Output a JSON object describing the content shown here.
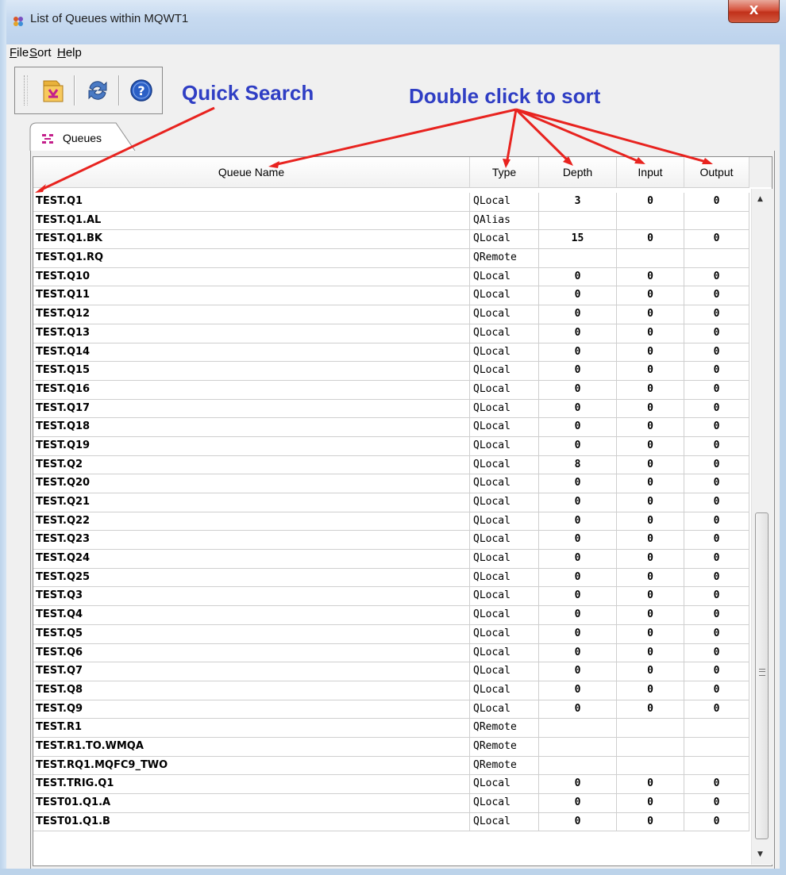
{
  "window": {
    "title": "List of Queues within MQWT1",
    "close_glyph": "X"
  },
  "menu": {
    "file": "ile",
    "file_key": "F",
    "sort": "ort",
    "sort_key": "S",
    "help": "elp",
    "help_key": "H"
  },
  "toolbar": {
    "icons": [
      "folder-open-icon",
      "refresh-icon",
      "help-icon"
    ]
  },
  "annotations": {
    "quick_search": "Quick Search",
    "double_click": "Double click to sort"
  },
  "tab": {
    "label": "Queues"
  },
  "columns": [
    "Queue Name",
    "Type",
    "Depth",
    "Input",
    "Output"
  ],
  "rows": [
    {
      "name": "TEST.Q1",
      "type": "QLocal",
      "depth": "3",
      "input": "0",
      "output": "0"
    },
    {
      "name": "TEST.Q1.AL",
      "type": "QAlias",
      "depth": "",
      "input": "",
      "output": ""
    },
    {
      "name": "TEST.Q1.BK",
      "type": "QLocal",
      "depth": "15",
      "input": "0",
      "output": "0"
    },
    {
      "name": "TEST.Q1.RQ",
      "type": "QRemote",
      "depth": "",
      "input": "",
      "output": ""
    },
    {
      "name": "TEST.Q10",
      "type": "QLocal",
      "depth": "0",
      "input": "0",
      "output": "0"
    },
    {
      "name": "TEST.Q11",
      "type": "QLocal",
      "depth": "0",
      "input": "0",
      "output": "0"
    },
    {
      "name": "TEST.Q12",
      "type": "QLocal",
      "depth": "0",
      "input": "0",
      "output": "0"
    },
    {
      "name": "TEST.Q13",
      "type": "QLocal",
      "depth": "0",
      "input": "0",
      "output": "0"
    },
    {
      "name": "TEST.Q14",
      "type": "QLocal",
      "depth": "0",
      "input": "0",
      "output": "0"
    },
    {
      "name": "TEST.Q15",
      "type": "QLocal",
      "depth": "0",
      "input": "0",
      "output": "0"
    },
    {
      "name": "TEST.Q16",
      "type": "QLocal",
      "depth": "0",
      "input": "0",
      "output": "0"
    },
    {
      "name": "TEST.Q17",
      "type": "QLocal",
      "depth": "0",
      "input": "0",
      "output": "0"
    },
    {
      "name": "TEST.Q18",
      "type": "QLocal",
      "depth": "0",
      "input": "0",
      "output": "0"
    },
    {
      "name": "TEST.Q19",
      "type": "QLocal",
      "depth": "0",
      "input": "0",
      "output": "0"
    },
    {
      "name": "TEST.Q2",
      "type": "QLocal",
      "depth": "8",
      "input": "0",
      "output": "0"
    },
    {
      "name": "TEST.Q20",
      "type": "QLocal",
      "depth": "0",
      "input": "0",
      "output": "0"
    },
    {
      "name": "TEST.Q21",
      "type": "QLocal",
      "depth": "0",
      "input": "0",
      "output": "0"
    },
    {
      "name": "TEST.Q22",
      "type": "QLocal",
      "depth": "0",
      "input": "0",
      "output": "0"
    },
    {
      "name": "TEST.Q23",
      "type": "QLocal",
      "depth": "0",
      "input": "0",
      "output": "0"
    },
    {
      "name": "TEST.Q24",
      "type": "QLocal",
      "depth": "0",
      "input": "0",
      "output": "0"
    },
    {
      "name": "TEST.Q25",
      "type": "QLocal",
      "depth": "0",
      "input": "0",
      "output": "0"
    },
    {
      "name": "TEST.Q3",
      "type": "QLocal",
      "depth": "0",
      "input": "0",
      "output": "0"
    },
    {
      "name": "TEST.Q4",
      "type": "QLocal",
      "depth": "0",
      "input": "0",
      "output": "0"
    },
    {
      "name": "TEST.Q5",
      "type": "QLocal",
      "depth": "0",
      "input": "0",
      "output": "0"
    },
    {
      "name": "TEST.Q6",
      "type": "QLocal",
      "depth": "0",
      "input": "0",
      "output": "0"
    },
    {
      "name": "TEST.Q7",
      "type": "QLocal",
      "depth": "0",
      "input": "0",
      "output": "0"
    },
    {
      "name": "TEST.Q8",
      "type": "QLocal",
      "depth": "0",
      "input": "0",
      "output": "0"
    },
    {
      "name": "TEST.Q9",
      "type": "QLocal",
      "depth": "0",
      "input": "0",
      "output": "0"
    },
    {
      "name": "TEST.R1",
      "type": "QRemote",
      "depth": "",
      "input": "",
      "output": ""
    },
    {
      "name": "TEST.R1.TO.WMQA",
      "type": "QRemote",
      "depth": "",
      "input": "",
      "output": ""
    },
    {
      "name": "TEST.RQ1.MQFC9_TWO",
      "type": "QRemote",
      "depth": "",
      "input": "",
      "output": ""
    },
    {
      "name": "TEST.TRIG.Q1",
      "type": "QLocal",
      "depth": "0",
      "input": "0",
      "output": "0"
    },
    {
      "name": "TEST01.Q1.A",
      "type": "QLocal",
      "depth": "0",
      "input": "0",
      "output": "0"
    },
    {
      "name": "TEST01.Q1.B",
      "type": "QLocal",
      "depth": "0",
      "input": "0",
      "output": "0"
    }
  ],
  "colors": {
    "annotation": "#2f3ec4",
    "arrow": "#e8231f",
    "close_button": "#c1301a"
  }
}
